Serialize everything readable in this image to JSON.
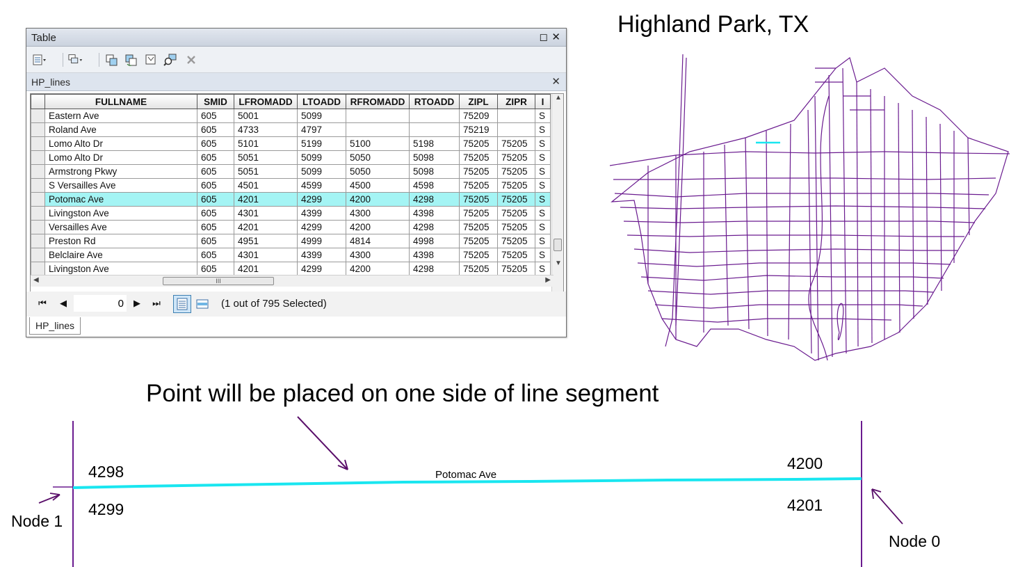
{
  "window": {
    "title": "Table",
    "subtab_title": "HP_lines",
    "bottom_tab": "HP_lines"
  },
  "toolbar": {
    "icons": [
      "table-options-icon",
      "related-tables-icon",
      "select-by-attributes-icon",
      "switch-selection-icon",
      "clear-selection-icon",
      "zoom-to-selected-icon",
      "delete-selected-icon"
    ]
  },
  "table": {
    "columns": [
      "FULLNAME",
      "SMID",
      "LFROMADD",
      "LTOADD",
      "RFROMADD",
      "RTOADD",
      "ZIPL",
      "ZIPR",
      "I"
    ],
    "rows": [
      [
        "Eastern Ave",
        "605",
        "5001",
        "5099",
        "",
        "",
        "75209",
        "",
        "S"
      ],
      [
        "Roland Ave",
        "605",
        "4733",
        "4797",
        "",
        "",
        "75219",
        "",
        "S"
      ],
      [
        "Lomo Alto Dr",
        "605",
        "5101",
        "5199",
        "5100",
        "5198",
        "75205",
        "75205",
        "S"
      ],
      [
        "Lomo Alto Dr",
        "605",
        "5051",
        "5099",
        "5050",
        "5098",
        "75205",
        "75205",
        "S"
      ],
      [
        "Armstrong Pkwy",
        "605",
        "5051",
        "5099",
        "5050",
        "5098",
        "75205",
        "75205",
        "S"
      ],
      [
        "S Versailles Ave",
        "605",
        "4501",
        "4599",
        "4500",
        "4598",
        "75205",
        "75205",
        "S"
      ],
      [
        "Potomac Ave",
        "605",
        "4201",
        "4299",
        "4200",
        "4298",
        "75205",
        "75205",
        "S"
      ],
      [
        "Livingston Ave",
        "605",
        "4301",
        "4399",
        "4300",
        "4398",
        "75205",
        "75205",
        "S"
      ],
      [
        "Versailles Ave",
        "605",
        "4201",
        "4299",
        "4200",
        "4298",
        "75205",
        "75205",
        "S"
      ],
      [
        "Preston Rd",
        "605",
        "4951",
        "4999",
        "4814",
        "4998",
        "75205",
        "75205",
        "S"
      ],
      [
        "Belclaire Ave",
        "605",
        "4301",
        "4399",
        "4300",
        "4398",
        "75205",
        "75205",
        "S"
      ],
      [
        "Livingston Ave",
        "605",
        "4201",
        "4299",
        "4200",
        "4298",
        "75205",
        "75205",
        "S"
      ]
    ],
    "selected_row": 6
  },
  "navigation": {
    "current_record": "0",
    "status": "(1 out of 795 Selected)"
  },
  "map": {
    "title": "Highland Park, TX",
    "line_color": "#6a1b8f",
    "highlight_color": "#19e6f0"
  },
  "diagram": {
    "caption": "Point will be placed on one side of line segment",
    "street_label": "Potomac Ave",
    "left_top_address": "4298",
    "left_bottom_address": "4299",
    "right_top_address": "4200",
    "right_bottom_address": "4201",
    "node_left": "Node 1",
    "node_right": "Node 0",
    "segment_color": "#19e6f0",
    "line_color": "#6a1b8f"
  }
}
